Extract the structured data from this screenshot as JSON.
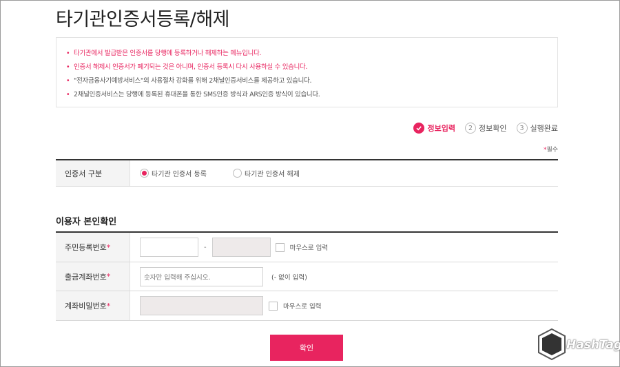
{
  "page": {
    "title": "타기관인증서등록/해제"
  },
  "notice": {
    "items": [
      {
        "text": "타기관에서 발급받은 인증서를 당행에 등록하거나 해제하는 메뉴입니다.",
        "highlight": true
      },
      {
        "text": "인증서 해제시 인증서가 폐기되는 것은 아니며, 인증서 등록시 다시 사용하실 수 있습니다.",
        "highlight": true
      },
      {
        "text": "\"전자금융사기예방서비스\"의 사용절차 강화를 위해 2채널인증서비스를 제공하고 있습니다.",
        "highlight": false
      },
      {
        "text": "2채널인증서비스는 당행에 등록된 휴대폰을 통한 SMS인증 방식과 ARS인증 방식이 있습니다.",
        "highlight": false
      }
    ]
  },
  "steps": [
    {
      "num": "",
      "label": "정보입력",
      "active": true
    },
    {
      "num": "2",
      "label": "정보확인",
      "active": false
    },
    {
      "num": "3",
      "label": "실행완료",
      "active": false
    }
  ],
  "required_note": {
    "star": "*",
    "text": "필수"
  },
  "cert_type": {
    "label": "인증서 구분",
    "options": [
      {
        "label": "타기관 인증서 등록",
        "selected": true
      },
      {
        "label": "타기관 인증서 해제",
        "selected": false
      }
    ]
  },
  "identity": {
    "title": "이용자 본인확인",
    "rrn": {
      "label": "주민등록번호",
      "star": "*",
      "dash": "-",
      "mouse_label": "마우스로 입력"
    },
    "account": {
      "label": "출금계좌번호",
      "star": "*",
      "placeholder": "숫자만 입력해 주십시오.",
      "hint": "(- 없이 입력)"
    },
    "password": {
      "label": "계좌비밀번호",
      "star": "*",
      "mouse_label": "마우스로 입력"
    }
  },
  "confirm_label": "확인",
  "watermark": {
    "text": "HashTag",
    "badge_text": "Hash Tag"
  },
  "colors": {
    "accent": "#e8245f",
    "border": "#333333",
    "label_bg": "#f4f4f4"
  }
}
